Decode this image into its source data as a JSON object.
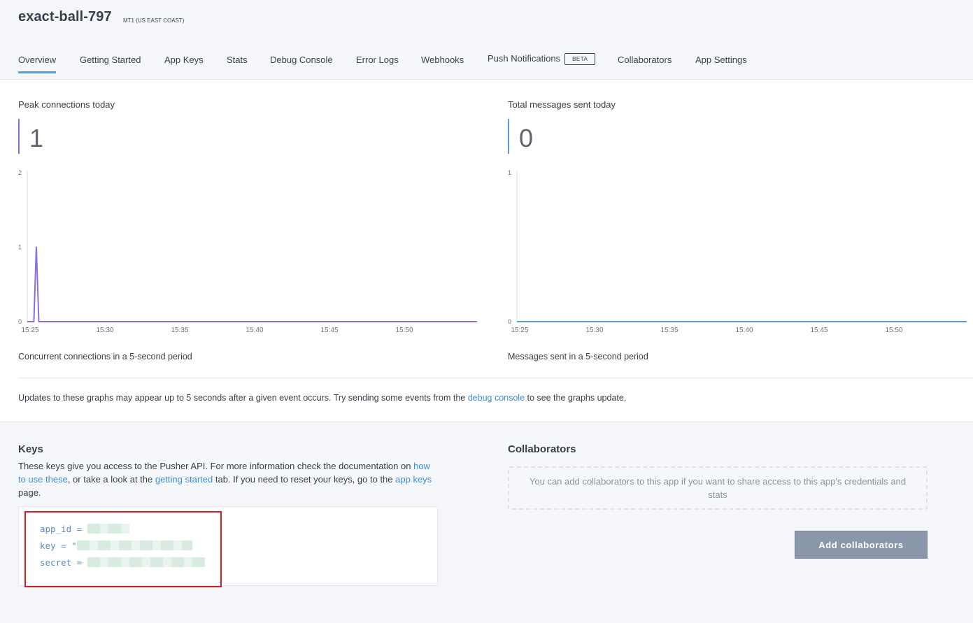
{
  "app": {
    "name": "exact-ball-797",
    "cluster": "MT1 (US EAST COAST)"
  },
  "tabs": [
    {
      "label": "Overview",
      "active": true
    },
    {
      "label": "Getting Started"
    },
    {
      "label": "App Keys"
    },
    {
      "label": "Stats"
    },
    {
      "label": "Debug Console"
    },
    {
      "label": "Error Logs"
    },
    {
      "label": "Webhooks"
    },
    {
      "label": "Push Notifications",
      "badge": "BETA"
    },
    {
      "label": "Collaborators"
    },
    {
      "label": "App Settings"
    }
  ],
  "stats": {
    "peak": {
      "label": "Peak connections today",
      "value": "1",
      "caption": "Concurrent connections in a 5-second period",
      "color": "#8a6fd6"
    },
    "messages": {
      "label": "Total messages sent today",
      "value": "0",
      "caption": "Messages sent in a 5-second period",
      "color": "#5a9bd8"
    }
  },
  "chart_data": [
    {
      "type": "line",
      "x_ticks": [
        "15:25",
        "15:30",
        "15:35",
        "15:40",
        "15:45",
        "15:50"
      ],
      "y_ticks": [
        0,
        1,
        2
      ],
      "ylim": [
        0,
        2
      ],
      "series": [
        {
          "color": "#8a6fd6",
          "x": [
            "15:25",
            "15:25:15",
            "15:25:25",
            "15:25:35",
            "15:55"
          ],
          "values": [
            0,
            0,
            1,
            0,
            0
          ]
        }
      ]
    },
    {
      "type": "line",
      "x_ticks": [
        "15:25",
        "15:30",
        "15:35",
        "15:40",
        "15:45",
        "15:50"
      ],
      "y_ticks": [
        0,
        1
      ],
      "ylim": [
        0,
        1
      ],
      "series": [
        {
          "color": "#5a9bd8",
          "x": [
            "15:25",
            "15:55"
          ],
          "values": [
            0,
            0
          ]
        }
      ]
    }
  ],
  "note": {
    "before": "Updates to these graphs may appear up to 5 seconds after a given event occurs. Try sending some events from the ",
    "link": "debug console",
    "after": " to see the graphs update."
  },
  "keys": {
    "title": "Keys",
    "desc_1": "These keys give you access to the Pusher API. For more information check the documentation on ",
    "link_1": "how to use these",
    "desc_2": ", or take a look at the ",
    "link_2": "getting started",
    "desc_3": " tab. If you need to reset your keys, go to the ",
    "link_3": "app keys",
    "desc_4": " page.",
    "app_id": "app_id = ",
    "key": "key = \"",
    "secret": "secret = "
  },
  "collaborators": {
    "title": "Collaborators",
    "empty": "You can add collaborators to this app if you want to share access to this app's credentials and stats",
    "button": "Add collaborators"
  }
}
